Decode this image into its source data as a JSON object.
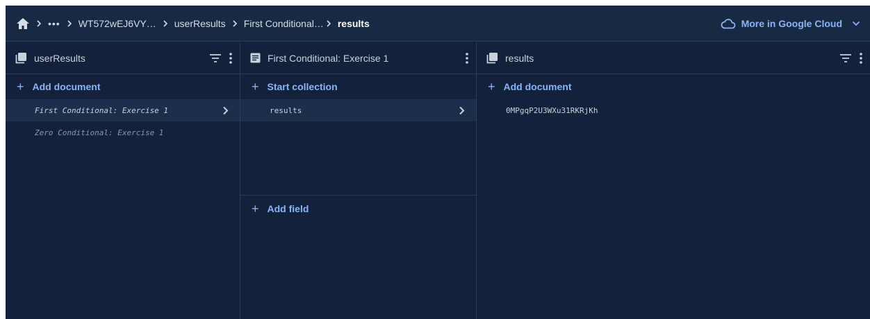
{
  "breadcrumb": {
    "ellipsis": "•••",
    "items": [
      "WT572wEJ6VY…",
      "userResults",
      "First Conditional…",
      "results"
    ]
  },
  "cloud_button": {
    "label": "More in Google Cloud"
  },
  "panels": {
    "collection": {
      "title": "userResults",
      "add_label": "Add document",
      "documents": [
        {
          "label": "First Conditional: Exercise 1"
        },
        {
          "label": "Zero Conditional: Exercise 1"
        }
      ]
    },
    "document": {
      "title": "First Conditional: Exercise 1",
      "start_collection_label": "Start collection",
      "subcollections": [
        {
          "label": "results"
        }
      ],
      "add_field_label": "Add field"
    },
    "subcollection": {
      "title": "results",
      "add_label": "Add document",
      "documents": [
        {
          "label": "0MPgqP2U3WXu31RKRjKh"
        }
      ]
    }
  },
  "colors": {
    "background": "#13223a",
    "accent": "#8ab4f8",
    "selected_row": "#1c2f4a",
    "border": "#2b3d57"
  }
}
